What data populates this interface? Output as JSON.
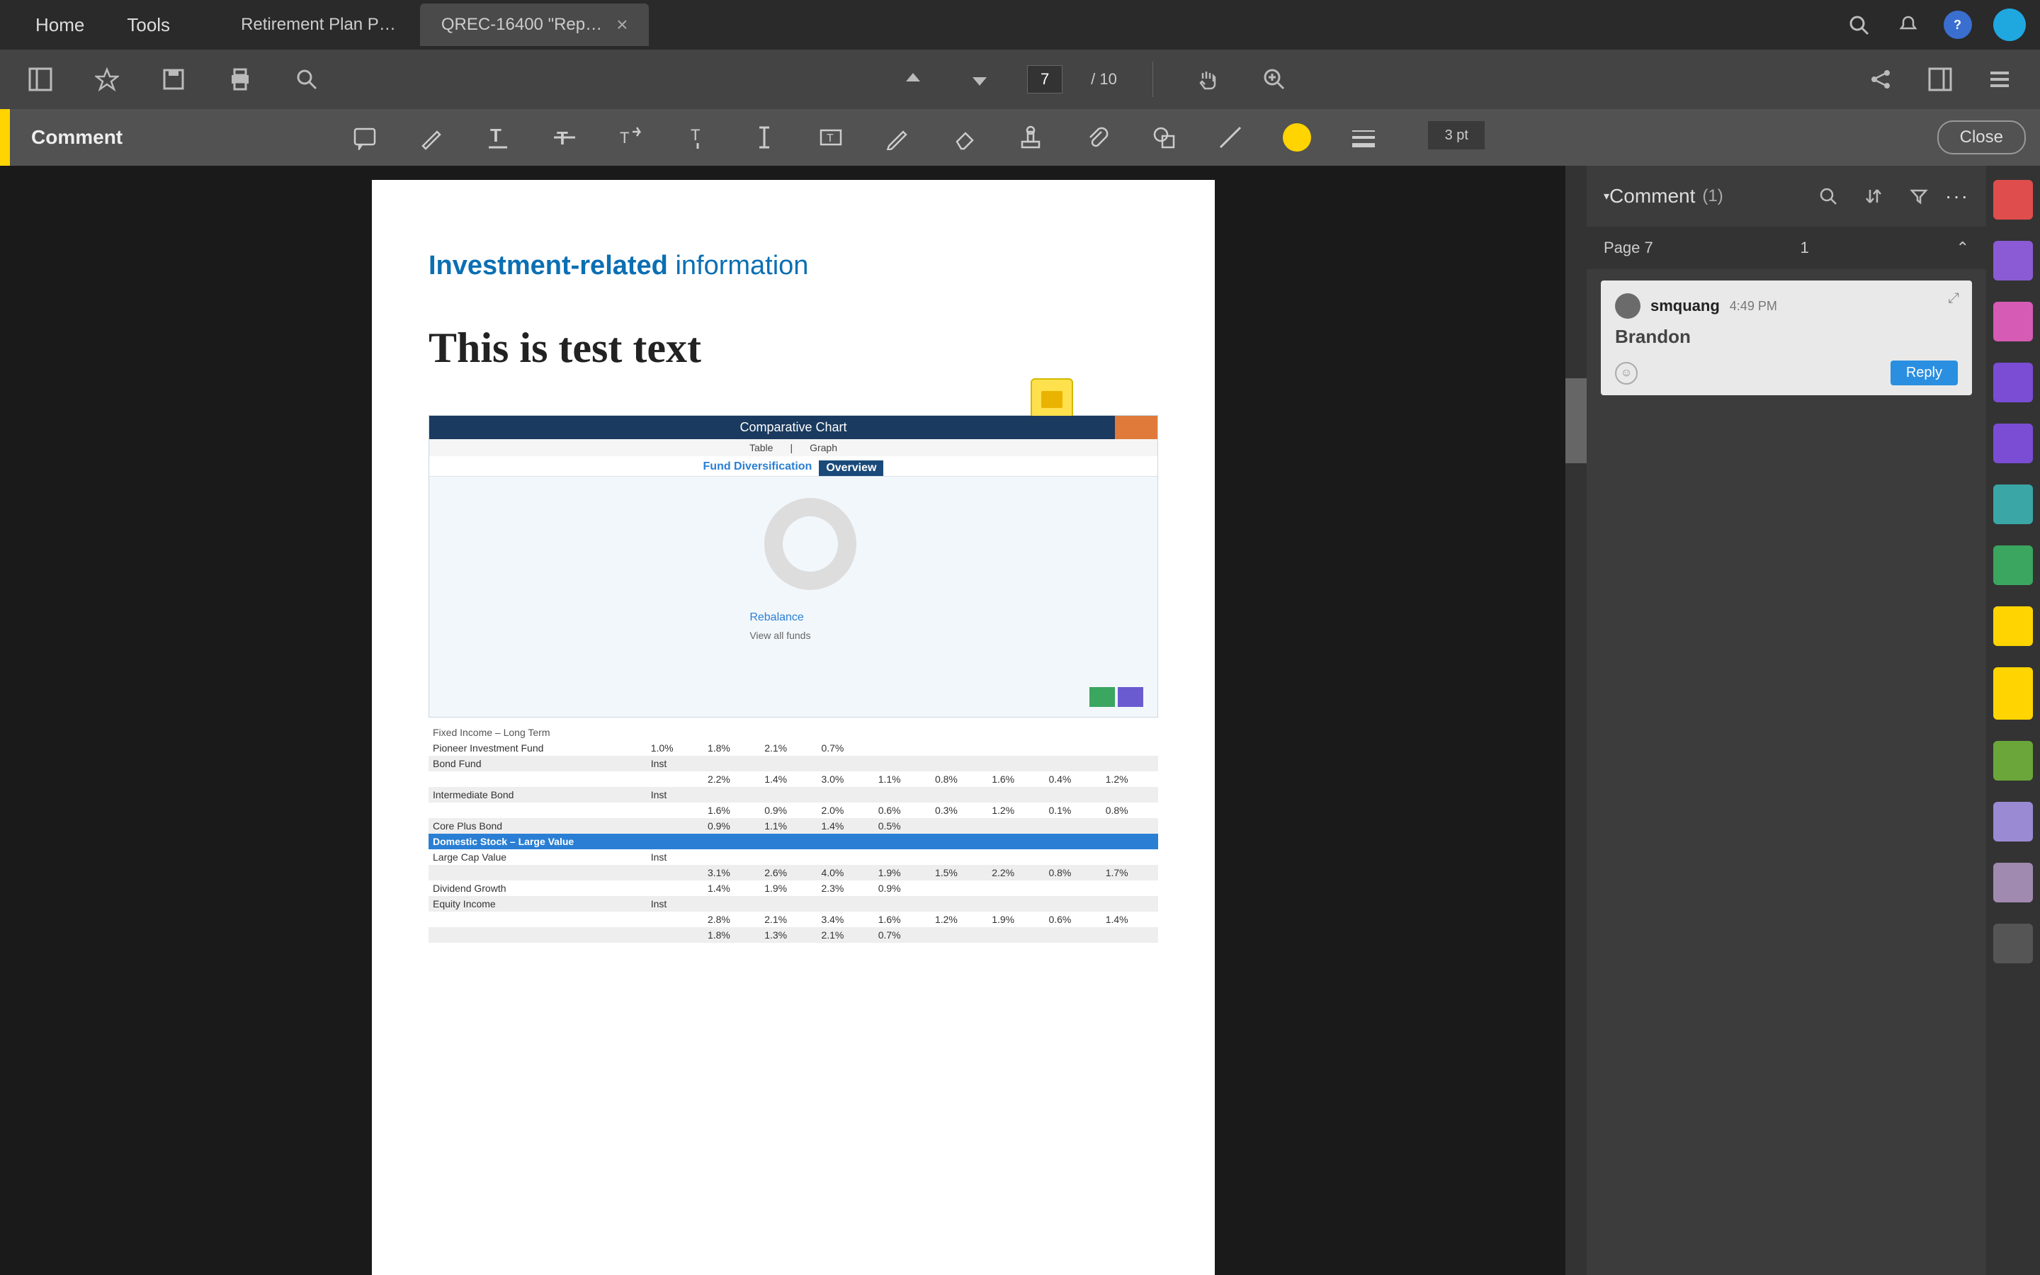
{
  "topbar": {
    "home": "Home",
    "tools": "Tools",
    "tabs": [
      {
        "label": "Retirement Plan P…",
        "active": false
      },
      {
        "label": "QREC-16400 \"Rep…",
        "active": true
      }
    ]
  },
  "toolbar": {
    "page_current": "7",
    "page_total_prefix": "/",
    "page_total": "10"
  },
  "comment_bar": {
    "label": "Comment",
    "color": "#ffd400",
    "line_weight": "3 pt",
    "close": "Close"
  },
  "page": {
    "title_heavy": "Investment-related",
    "title_light": "information",
    "test_text": "This is test text"
  },
  "chart": {
    "header": "Comparative Chart",
    "subtabs": [
      "Table",
      "Graph"
    ],
    "title_blue": "Fund Diversification",
    "title_navy": "Overview",
    "legend_link": "Rebalance",
    "legend_sub": "View all funds",
    "donut_value": "0%"
  },
  "table": {
    "section1": "Fixed Income – Long Term",
    "section2": "Domestic Stock – Large Value",
    "rows1": [
      [
        "Pioneer Investment Fund",
        "1.0%",
        "1.8%",
        "2.1%",
        "0.7%",
        "",
        "",
        "",
        "",
        ""
      ],
      [
        "Bond Fund",
        "Inst",
        "",
        "",
        "",
        "",
        "",
        "",
        "",
        ""
      ],
      [
        "",
        "",
        "2.2%",
        "1.4%",
        "3.0%",
        "1.1%",
        "0.8%",
        "1.6%",
        "0.4%",
        "1.2%"
      ],
      [
        "Intermediate Bond",
        "Inst",
        "",
        "",
        "",
        "",
        "",
        "",
        "",
        ""
      ],
      [
        "",
        "",
        "1.6%",
        "0.9%",
        "2.0%",
        "0.6%",
        "0.3%",
        "1.2%",
        "0.1%",
        "0.8%"
      ],
      [
        "Core Plus Bond",
        "",
        "0.9%",
        "1.1%",
        "1.4%",
        "0.5%",
        "",
        "",
        "",
        ""
      ]
    ],
    "rows2": [
      [
        "Large Cap Value",
        "Inst",
        "",
        "",
        "",
        "",
        "",
        "",
        "",
        ""
      ],
      [
        "",
        "",
        "3.1%",
        "2.6%",
        "4.0%",
        "1.9%",
        "1.5%",
        "2.2%",
        "0.8%",
        "1.7%"
      ],
      [
        "Dividend Growth",
        "",
        "1.4%",
        "1.9%",
        "2.3%",
        "0.9%",
        "",
        "",
        "",
        ""
      ],
      [
        "Equity Income",
        "Inst",
        "",
        "",
        "",
        "",
        "",
        "",
        "",
        ""
      ],
      [
        "",
        "",
        "2.8%",
        "2.1%",
        "3.4%",
        "1.6%",
        "1.2%",
        "1.9%",
        "0.6%",
        "1.4%"
      ],
      [
        "",
        "",
        "1.8%",
        "1.3%",
        "2.1%",
        "0.7%",
        "",
        "",
        "",
        ""
      ]
    ]
  },
  "panel": {
    "title": "Comment",
    "count": "1",
    "thread_label": "Page 7",
    "thread_count": "1",
    "dots": "···"
  },
  "comment_card": {
    "user": "smquang",
    "time": "4:49 PM",
    "body": "Brandon",
    "reply": "Reply"
  },
  "icons": {
    "search": "search",
    "bell": "bell",
    "help": "help",
    "share": "share",
    "panel": "panel",
    "save": "save",
    "print": "print",
    "find": "find",
    "up": "up",
    "down": "down",
    "zoom": "zoom",
    "rotate": "rotate",
    "pen": "pen",
    "highlight": "highlight",
    "underline": "underline",
    "strike": "strike",
    "textbox": "textbox",
    "callout": "callout",
    "textnote": "textnote",
    "draw": "draw",
    "erase": "erase",
    "stamp": "stamp",
    "attach": "attach",
    "shape": "shape",
    "drawline": "drawline",
    "filter": "filter",
    "sort": "sort",
    "emoji": "☺"
  }
}
